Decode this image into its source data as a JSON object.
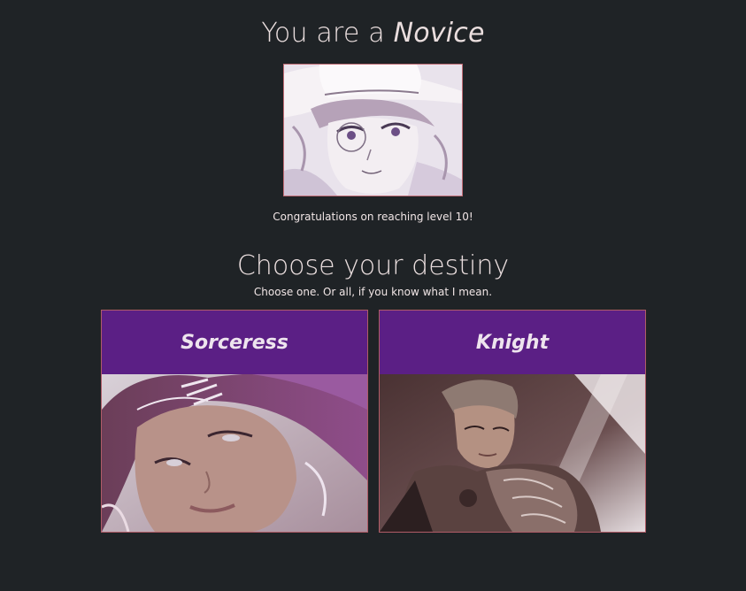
{
  "rank": {
    "prefix": "You are a",
    "name": "Novice"
  },
  "congrats_text": "Congratulations on reaching level 10!",
  "destiny": {
    "title": "Choose your destiny",
    "subtitle": "Choose one. Or all, if you know what I mean."
  },
  "cards": [
    {
      "title": "Sorceress",
      "image": "sorceress-portrait"
    },
    {
      "title": "Knight",
      "image": "knight-portrait"
    }
  ],
  "colors": {
    "background": "#1f2326",
    "card_header": "#5b1f85",
    "card_border": "#b05c67",
    "text": "#eadede"
  }
}
